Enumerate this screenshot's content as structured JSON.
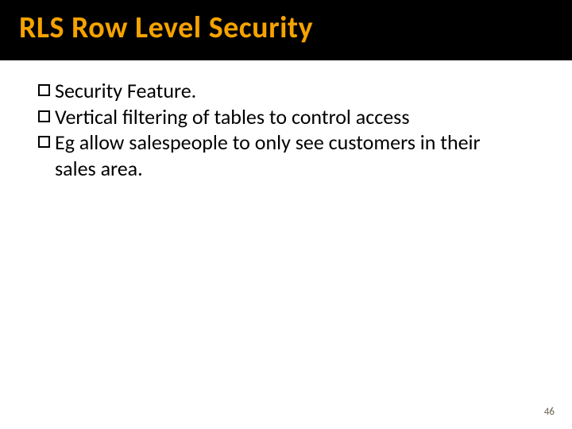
{
  "slide": {
    "title": "RLS Row Level Security",
    "bullets": [
      {
        "text": "Security Feature."
      },
      {
        "text": "Vertical filtering of tables to control access"
      },
      {
        "text": "Eg allow salespeople to only see customers in their sales area."
      }
    ],
    "page_number": "46"
  }
}
